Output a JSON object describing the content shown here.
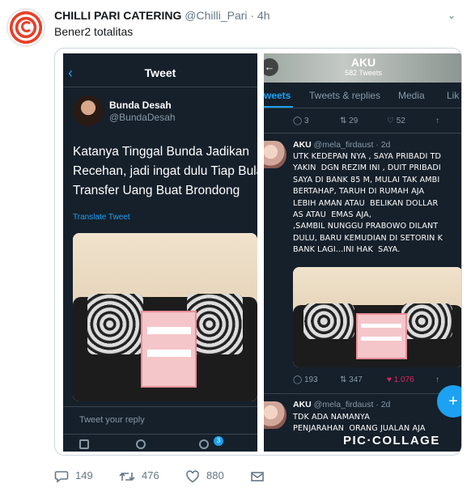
{
  "tweet": {
    "display_name": "CHILLI PARI CATERING",
    "handle": "@Chilli_Pari",
    "time": "· 4h",
    "text": "Bener2 totalitas"
  },
  "stats": {
    "replies": "149",
    "retweets": "476",
    "likes": "880"
  },
  "left_shot": {
    "title": "Tweet",
    "user_name": "Bunda Desah",
    "user_handle": "@BundaDesah",
    "lines": [
      "Katanya Tinggal Bunda Jadikan",
      "Recehan, jadi ingat dulu Tiap Bulan",
      "Transfer Uang Buat Brondong"
    ],
    "translate": "Translate Tweet",
    "reply_placeholder": "Tweet your reply",
    "badge": "3"
  },
  "right_shot": {
    "title": "AKU",
    "tweet_count": "582 Tweets",
    "tabs": [
      "weets",
      "Tweets & replies",
      "Media",
      "Lik"
    ],
    "top_actions": {
      "replies": "3",
      "retweets": "29",
      "likes": "52"
    },
    "tweet1": {
      "name": "AKU",
      "handle": "@mela_firdaust · 2d",
      "lines": [
        "UTK KEDEPAN NYA , SAYA PRIBADI TD",
        "YAKIN  DGN REZIM INI , DUIT PRIBADI",
        "SAYA DI BANK 85 M, MULAI TAK AMBI",
        "BERTAHAP, TARUH DI RUMAH AJA",
        "LEBIH AMAN ATAU  BELIKAN DOLLAR",
        "AS ATAU  EMAS AJA,",
        ",SAMBIL NUNGGU PRABOWO DILANT",
        "DULU, BARU KEMUDIAN DI SETORIN K",
        "BANK LAGI...INI HAK  SAYA."
      ],
      "replies": "193",
      "retweets": "347",
      "likes": "1.076"
    },
    "tweet2": {
      "name": "AKU",
      "handle": "@mela_firdaust · 2d",
      "lines": [
        "TDK ADA NAMANYA",
        "PENJARAHAN  ORANG JUALAN AJA"
      ]
    },
    "watermark": "PIC·COLLAGE",
    "fab": "+"
  },
  "colors": {
    "twitter_blue": "#1da1f2",
    "dark_bg": "#15202b",
    "like_red": "#e0245e"
  }
}
